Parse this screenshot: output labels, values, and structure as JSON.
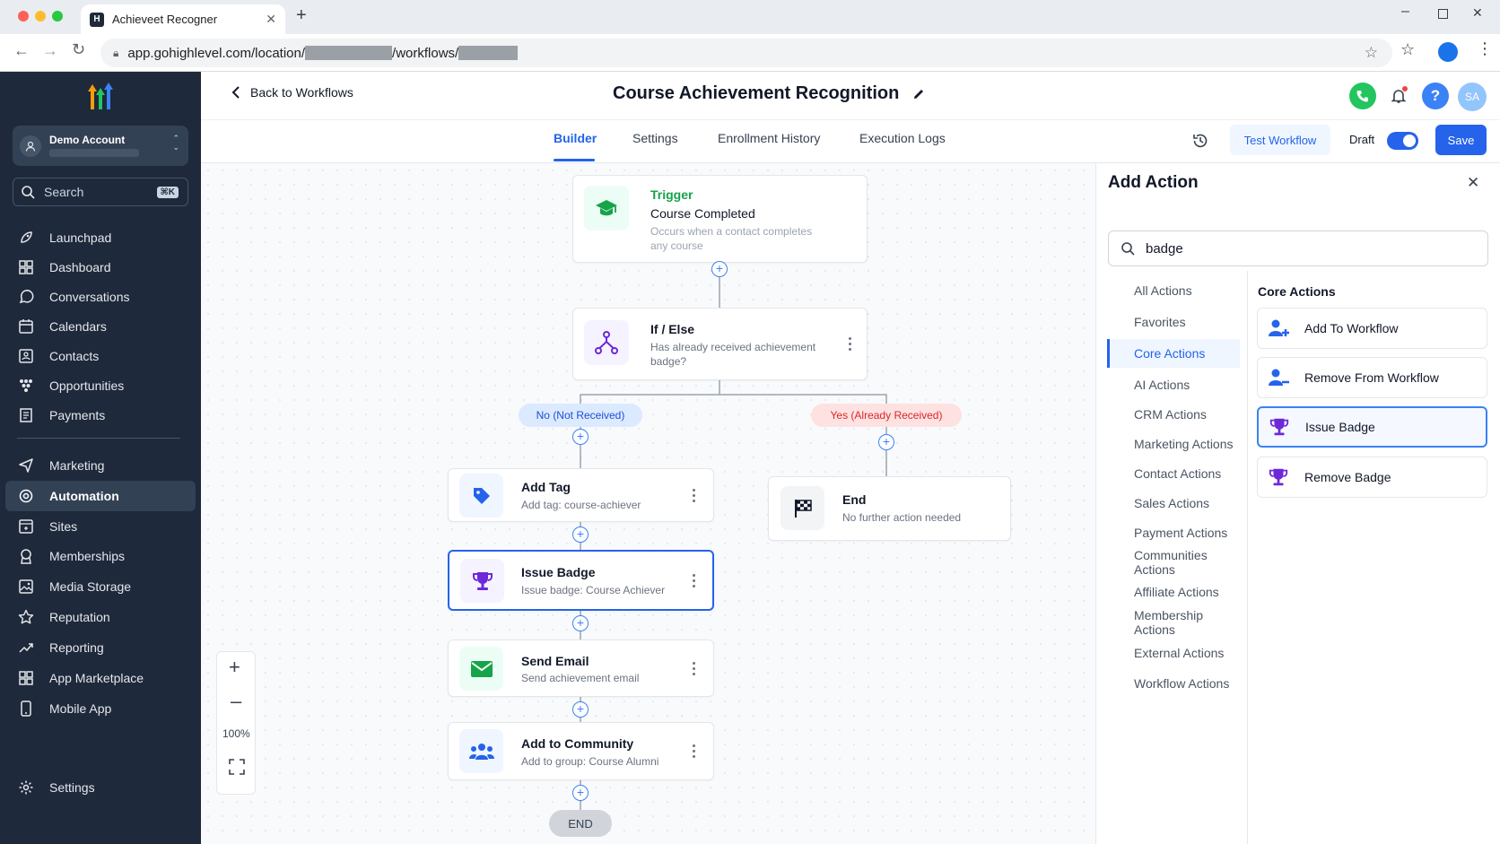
{
  "browser": {
    "tab_title": "Achieveet Recogner",
    "url_prefix": "app.gohighlevel.com/location/",
    "url_mid": "/workflows/"
  },
  "sidebar": {
    "account_name": "Demo Account",
    "search_placeholder": "Search",
    "search_shortcut": "⌘K",
    "items": [
      {
        "label": "Launchpad",
        "icon": "rocket-icon"
      },
      {
        "label": "Dashboard",
        "icon": "grid-icon"
      },
      {
        "label": "Conversations",
        "icon": "chat-icon"
      },
      {
        "label": "Calendars",
        "icon": "calendar-icon"
      },
      {
        "label": "Contacts",
        "icon": "contacts-icon"
      },
      {
        "label": "Opportunities",
        "icon": "funnel-icon"
      },
      {
        "label": "Payments",
        "icon": "receipt-icon"
      },
      {
        "label": "Marketing",
        "icon": "send-icon"
      },
      {
        "label": "Automation",
        "icon": "automation-icon"
      },
      {
        "label": "Sites",
        "icon": "sites-icon"
      },
      {
        "label": "Memberships",
        "icon": "membership-icon"
      },
      {
        "label": "Media Storage",
        "icon": "media-icon"
      },
      {
        "label": "Reputation",
        "icon": "star-icon"
      },
      {
        "label": "Reporting",
        "icon": "trend-icon"
      },
      {
        "label": "App Marketplace",
        "icon": "apps-icon"
      },
      {
        "label": "Mobile App",
        "icon": "phone-icon"
      }
    ],
    "settings_label": "Settings"
  },
  "header": {
    "back_label": "Back to Workflows",
    "title": "Course Achievement Recognition",
    "avatar_initials": "SA",
    "help_glyph": "?",
    "tabs": [
      "Builder",
      "Settings",
      "Enrollment History",
      "Execution Logs"
    ],
    "active_tab": "Builder",
    "test_workflow_label": "Test Workflow",
    "draft_label": "Draft",
    "save_label": "Save"
  },
  "workflow": {
    "trigger": {
      "kicker": "Trigger",
      "title": "Course Completed",
      "desc": "Occurs when a contact completes any course"
    },
    "ifelse": {
      "title": "If / Else",
      "desc": "Has already received achievement badge?"
    },
    "branch_no": "No (Not Received)",
    "branch_yes": "Yes (Already Received)",
    "steps": [
      {
        "title": "Add Tag",
        "desc": "Add tag: course-achiever"
      },
      {
        "title": "Issue Badge",
        "desc": "Issue badge: Course Achiever"
      },
      {
        "title": "Send Email",
        "desc": "Send achievement email"
      },
      {
        "title": "Add to Community",
        "desc": "Add to group: Course Alumni"
      }
    ],
    "end_branch": {
      "title": "End",
      "desc": "No further action needed"
    },
    "end_label": "END",
    "zoom": "100%"
  },
  "panel": {
    "title": "Add Action",
    "search_value": "badge",
    "categories": [
      "All Actions",
      "Favorites",
      "Core Actions",
      "AI Actions",
      "CRM Actions",
      "Marketing Actions",
      "Contact Actions",
      "Sales Actions",
      "Payment Actions",
      "Communities Actions",
      "Affiliate Actions",
      "Membership Actions",
      "External Actions",
      "Workflow Actions"
    ],
    "active_category": "Core Actions",
    "section_title": "Core Actions",
    "actions": [
      {
        "label": "Add To Workflow",
        "icon": "user-plus-icon"
      },
      {
        "label": "Remove From Workflow",
        "icon": "user-minus-icon"
      },
      {
        "label": "Issue Badge",
        "icon": "trophy-icon"
      },
      {
        "label": "Remove Badge",
        "icon": "trophy-icon"
      }
    ]
  },
  "colors": {
    "primary": "#2563eb",
    "sidebar": "#1e293b",
    "green": "#16a34a",
    "purple": "#6d28d9",
    "red_branch": "#dc2626"
  }
}
